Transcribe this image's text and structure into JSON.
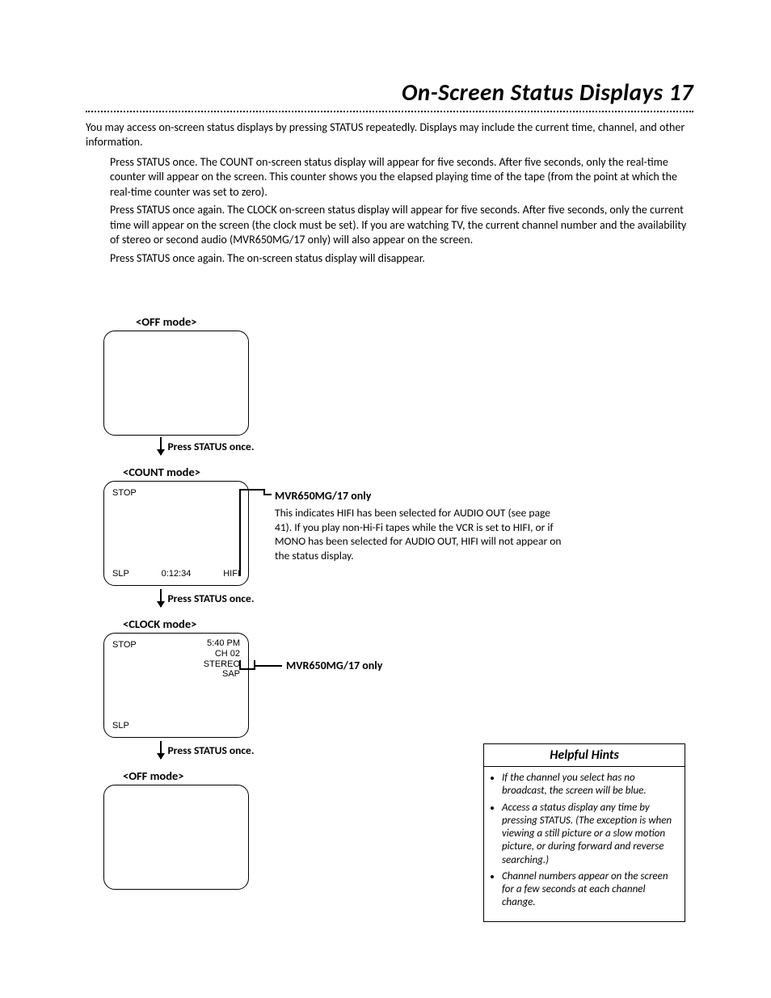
{
  "page": {
    "title": "On-Screen Status Displays  17",
    "intro": "You may access on-screen status displays by pressing STATUS repeatedly. Displays may include the current time, channel, and other information.",
    "p1": "Press STATUS once. The COUNT on-screen status display will appear for five seconds. After five seconds, only the real-time counter will appear on the screen. This counter shows you the elapsed playing time of the tape (from the point at which the real-time counter was set to zero).",
    "p2": "Press STATUS once again. The CLOCK on-screen status display will appear for five seconds. After five seconds, only the current time will appear on the screen (the clock must be set). If you are watching TV, the current channel number and the availability of stereo or second audio (MVR650MG/17 only) will also appear on the screen.",
    "p3": "Press STATUS once again. The on-screen status display will disappear."
  },
  "modes": {
    "off1": "<OFF mode>",
    "count": "<COUNT mode>",
    "clock": "<CLOCK mode>",
    "off2": "<OFF mode>"
  },
  "press": {
    "once": "Press STATUS once."
  },
  "screens": {
    "count": {
      "tl": "STOP",
      "bl": "SLP",
      "bc": "0:12:34",
      "br": "HIFI"
    },
    "clock": {
      "tl": "STOP",
      "tr_time": "5:40 PM",
      "tr_ch": "CH 02",
      "tr_stereo": "STEREO",
      "tr_sap": "SAP",
      "bl": "SLP"
    }
  },
  "callouts": {
    "hifi_head": "MVR650MG/17 only",
    "hifi_body": "This indicates HIFI has been selected for AUDIO OUT (see page 41).  If you play non-Hi-Fi tapes while the VCR is set to HIFI, or if MONO has been selected for AUDIO OUT, HIFI will not appear on the status display.",
    "sap_head": "MVR650MG/17 only"
  },
  "hints": {
    "title": "Helpful Hints",
    "items": [
      "If the channel you select has no broadcast, the screen will be blue.",
      "Access a status display any time by pressing STATUS. (The exception is when viewing a still picture or a slow motion picture, or during forward and reverse searching.)",
      "Channel numbers appear on the screen for a few seconds at each channel change."
    ]
  }
}
